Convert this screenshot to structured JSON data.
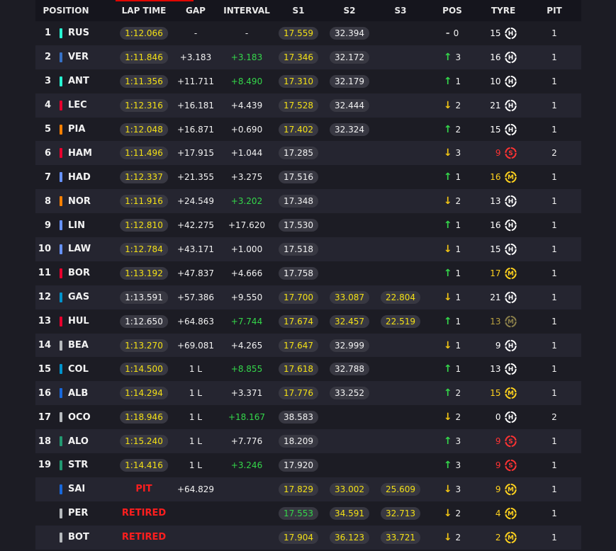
{
  "headers": {
    "position": "POSITION",
    "lap_time": "LAP TIME",
    "gap": "GAP",
    "interval": "INTERVAL",
    "s1": "S1",
    "s2": "S2",
    "s3": "S3",
    "pos": "POS",
    "tyre": "TYRE",
    "pit": "PIT"
  },
  "colors": {
    "pill_yellow": "#f3e015",
    "pill_green": "#34d74a",
    "retired": "#ff1e1e",
    "arrow_up": "#34d74a",
    "arrow_down": "#f3c613"
  },
  "rows": [
    {
      "pos": "1",
      "code": "RUS",
      "team_color": "#27f4d2",
      "lap": "1:12.066",
      "lap_pb": true,
      "gap": "-",
      "interval": "-",
      "interval_green": false,
      "s1": "17.559",
      "s1_c": "y",
      "s2": "32.394",
      "s2_c": "w",
      "s3": "",
      "s3_c": "",
      "pos_dir": "eq",
      "pos_change": "0",
      "tyre_laps": "15",
      "tyre": "H",
      "tyre_col": "#ffffff",
      "laps_col": "#ffffff",
      "pit": "1"
    },
    {
      "pos": "2",
      "code": "VER",
      "team_color": "#3671c6",
      "lap": "1:11.846",
      "lap_pb": true,
      "gap": "+3.183",
      "interval": "+3.183",
      "interval_green": true,
      "s1": "17.346",
      "s1_c": "y",
      "s2": "32.172",
      "s2_c": "w",
      "s3": "",
      "s3_c": "",
      "pos_dir": "up",
      "pos_change": "3",
      "tyre_laps": "16",
      "tyre": "H",
      "tyre_col": "#ffffff",
      "laps_col": "#ffffff",
      "pit": "1"
    },
    {
      "pos": "3",
      "code": "ANT",
      "team_color": "#27f4d2",
      "lap": "1:11.356",
      "lap_pb": true,
      "gap": "+11.711",
      "interval": "+8.490",
      "interval_green": true,
      "s1": "17.310",
      "s1_c": "y",
      "s2": "32.179",
      "s2_c": "w",
      "s3": "",
      "s3_c": "",
      "pos_dir": "up",
      "pos_change": "1",
      "tyre_laps": "10",
      "tyre": "H",
      "tyre_col": "#ffffff",
      "laps_col": "#ffffff",
      "pit": "1"
    },
    {
      "pos": "4",
      "code": "LEC",
      "team_color": "#e8002d",
      "lap": "1:12.316",
      "lap_pb": true,
      "gap": "+16.181",
      "interval": "+4.439",
      "interval_green": false,
      "s1": "17.528",
      "s1_c": "y",
      "s2": "32.444",
      "s2_c": "w",
      "s3": "",
      "s3_c": "",
      "pos_dir": "down",
      "pos_change": "2",
      "tyre_laps": "21",
      "tyre": "H",
      "tyre_col": "#ffffff",
      "laps_col": "#ffffff",
      "pit": "1"
    },
    {
      "pos": "5",
      "code": "PIA",
      "team_color": "#ff8000",
      "lap": "1:12.048",
      "lap_pb": true,
      "gap": "+16.871",
      "interval": "+0.690",
      "interval_green": false,
      "s1": "17.402",
      "s1_c": "y",
      "s2": "32.324",
      "s2_c": "w",
      "s3": "",
      "s3_c": "",
      "pos_dir": "up",
      "pos_change": "2",
      "tyre_laps": "15",
      "tyre": "H",
      "tyre_col": "#ffffff",
      "laps_col": "#ffffff",
      "pit": "1"
    },
    {
      "pos": "6",
      "code": "HAM",
      "team_color": "#e8002d",
      "lap": "1:11.496",
      "lap_pb": true,
      "gap": "+17.915",
      "interval": "+1.044",
      "interval_green": false,
      "s1": "17.285",
      "s1_c": "w",
      "s2": "",
      "s2_c": "",
      "s3": "",
      "s3_c": "",
      "pos_dir": "down",
      "pos_change": "3",
      "tyre_laps": "9",
      "tyre": "S",
      "tyre_col": "#ff3333",
      "laps_col": "#ff3333",
      "pit": "2"
    },
    {
      "pos": "7",
      "code": "HAD",
      "team_color": "#6692ff",
      "lap": "1:12.337",
      "lap_pb": true,
      "gap": "+21.355",
      "interval": "+3.275",
      "interval_green": false,
      "s1": "17.516",
      "s1_c": "w",
      "s2": "",
      "s2_c": "",
      "s3": "",
      "s3_c": "",
      "pos_dir": "up",
      "pos_change": "1",
      "tyre_laps": "16",
      "tyre": "M",
      "tyre_col": "#ffd21e",
      "laps_col": "#ffd21e",
      "pit": "1"
    },
    {
      "pos": "8",
      "code": "NOR",
      "team_color": "#ff8000",
      "lap": "1:11.916",
      "lap_pb": true,
      "gap": "+24.549",
      "interval": "+3.202",
      "interval_green": true,
      "s1": "17.348",
      "s1_c": "w",
      "s2": "",
      "s2_c": "",
      "s3": "",
      "s3_c": "",
      "pos_dir": "down",
      "pos_change": "2",
      "tyre_laps": "13",
      "tyre": "H",
      "tyre_col": "#ffffff",
      "laps_col": "#ffffff",
      "pit": "1"
    },
    {
      "pos": "9",
      "code": "LIN",
      "team_color": "#6692ff",
      "lap": "1:12.810",
      "lap_pb": true,
      "gap": "+42.275",
      "interval": "+17.620",
      "interval_green": false,
      "s1": "17.530",
      "s1_c": "w",
      "s2": "",
      "s2_c": "",
      "s3": "",
      "s3_c": "",
      "pos_dir": "up",
      "pos_change": "1",
      "tyre_laps": "16",
      "tyre": "H",
      "tyre_col": "#ffffff",
      "laps_col": "#ffffff",
      "pit": "1"
    },
    {
      "pos": "10",
      "code": "LAW",
      "team_color": "#6692ff",
      "lap": "1:12.784",
      "lap_pb": true,
      "gap": "+43.171",
      "interval": "+1.000",
      "interval_green": false,
      "s1": "17.518",
      "s1_c": "w",
      "s2": "",
      "s2_c": "",
      "s3": "",
      "s3_c": "",
      "pos_dir": "down",
      "pos_change": "1",
      "tyre_laps": "15",
      "tyre": "H",
      "tyre_col": "#ffffff",
      "laps_col": "#ffffff",
      "pit": "1"
    },
    {
      "pos": "11",
      "code": "BOR",
      "team_color": "#e8002d",
      "lap": "1:13.192",
      "lap_pb": true,
      "gap": "+47.837",
      "interval": "+4.666",
      "interval_green": false,
      "s1": "17.758",
      "s1_c": "w",
      "s2": "",
      "s2_c": "",
      "s3": "",
      "s3_c": "",
      "pos_dir": "up",
      "pos_change": "1",
      "tyre_laps": "17",
      "tyre": "M",
      "tyre_col": "#ffd21e",
      "laps_col": "#ffd21e",
      "pit": "1"
    },
    {
      "pos": "12",
      "code": "GAS",
      "team_color": "#0093cc",
      "lap": "1:13.591",
      "lap_pb": false,
      "gap": "+57.386",
      "interval": "+9.550",
      "interval_green": false,
      "s1": "17.700",
      "s1_c": "y",
      "s2": "33.087",
      "s2_c": "y",
      "s3": "22.804",
      "s3_c": "y",
      "pos_dir": "down",
      "pos_change": "1",
      "tyre_laps": "21",
      "tyre": "H",
      "tyre_col": "#ffffff",
      "laps_col": "#ffffff",
      "pit": "1"
    },
    {
      "pos": "13",
      "code": "HUL",
      "team_color": "#e8002d",
      "lap": "1:12.650",
      "lap_pb": false,
      "gap": "+64.863",
      "interval": "+7.744",
      "interval_green": true,
      "s1": "17.674",
      "s1_c": "y",
      "s2": "32.457",
      "s2_c": "y",
      "s3": "22.519",
      "s3_c": "y",
      "pos_dir": "up",
      "pos_change": "1",
      "tyre_laps": "13",
      "tyre": "M",
      "tyre_col": "#8a7f4a",
      "laps_col": "#b8a040",
      "pit": "1"
    },
    {
      "pos": "14",
      "code": "BEA",
      "team_color": "#b6babd",
      "lap": "1:13.270",
      "lap_pb": true,
      "gap": "+69.081",
      "interval": "+4.265",
      "interval_green": false,
      "s1": "17.647",
      "s1_c": "y",
      "s2": "32.999",
      "s2_c": "w",
      "s3": "",
      "s3_c": "",
      "pos_dir": "down",
      "pos_change": "1",
      "tyre_laps": "9",
      "tyre": "H",
      "tyre_col": "#ffffff",
      "laps_col": "#ffffff",
      "pit": "1"
    },
    {
      "pos": "15",
      "code": "COL",
      "team_color": "#0093cc",
      "lap": "1:14.500",
      "lap_pb": true,
      "gap": "1 L",
      "interval": "+8.855",
      "interval_green": true,
      "s1": "17.618",
      "s1_c": "y",
      "s2": "32.788",
      "s2_c": "w",
      "s3": "",
      "s3_c": "",
      "pos_dir": "up",
      "pos_change": "1",
      "tyre_laps": "13",
      "tyre": "H",
      "tyre_col": "#ffffff",
      "laps_col": "#ffffff",
      "pit": "1"
    },
    {
      "pos": "16",
      "code": "ALB",
      "team_color": "#1868db",
      "lap": "1:14.294",
      "lap_pb": true,
      "gap": "1 L",
      "interval": "+3.371",
      "interval_green": false,
      "s1": "17.776",
      "s1_c": "y",
      "s2": "33.252",
      "s2_c": "w",
      "s3": "",
      "s3_c": "",
      "pos_dir": "up",
      "pos_change": "2",
      "tyre_laps": "15",
      "tyre": "M",
      "tyre_col": "#ffd21e",
      "laps_col": "#ffd21e",
      "pit": "1"
    },
    {
      "pos": "17",
      "code": "OCO",
      "team_color": "#b6babd",
      "lap": "1:18.946",
      "lap_pb": true,
      "gap": "1 L",
      "interval": "+18.167",
      "interval_green": true,
      "s1": "38.583",
      "s1_c": "w",
      "s2": "",
      "s2_c": "",
      "s3": "",
      "s3_c": "",
      "pos_dir": "down",
      "pos_change": "2",
      "tyre_laps": "0",
      "tyre": "H",
      "tyre_col": "#ffffff",
      "laps_col": "#ffffff",
      "pit": "2"
    },
    {
      "pos": "18",
      "code": "ALO",
      "team_color": "#229971",
      "lap": "1:15.240",
      "lap_pb": true,
      "gap": "1 L",
      "interval": "+7.776",
      "interval_green": false,
      "s1": "18.209",
      "s1_c": "w",
      "s2": "",
      "s2_c": "",
      "s3": "",
      "s3_c": "",
      "pos_dir": "up",
      "pos_change": "3",
      "tyre_laps": "9",
      "tyre": "S",
      "tyre_col": "#ff3333",
      "laps_col": "#ff3333",
      "pit": "1"
    },
    {
      "pos": "19",
      "code": "STR",
      "team_color": "#229971",
      "lap": "1:14.416",
      "lap_pb": true,
      "gap": "1 L",
      "interval": "+3.246",
      "interval_green": true,
      "s1": "17.920",
      "s1_c": "w",
      "s2": "",
      "s2_c": "",
      "s3": "",
      "s3_c": "",
      "pos_dir": "up",
      "pos_change": "3",
      "tyre_laps": "9",
      "tyre": "S",
      "tyre_col": "#ff3333",
      "laps_col": "#ff3333",
      "pit": "1"
    },
    {
      "pos": "",
      "code": "SAI",
      "team_color": "#1868db",
      "lap": "PIT",
      "lap_status": true,
      "gap": "+64.829",
      "interval": "",
      "interval_green": false,
      "s1": "17.829",
      "s1_c": "y",
      "s2": "33.002",
      "s2_c": "y",
      "s3": "25.609",
      "s3_c": "y",
      "pos_dir": "down",
      "pos_change": "3",
      "tyre_laps": "9",
      "tyre": "M",
      "tyre_col": "#ffd21e",
      "laps_col": "#ffd21e",
      "pit": "1"
    },
    {
      "pos": "",
      "code": "PER",
      "team_color": "#b6babd",
      "lap": "RETIRED",
      "lap_status": true,
      "gap": "",
      "interval": "",
      "interval_green": false,
      "s1": "17.553",
      "s1_c": "g",
      "s2": "34.591",
      "s2_c": "y",
      "s3": "32.713",
      "s3_c": "y",
      "pos_dir": "down",
      "pos_change": "2",
      "tyre_laps": "4",
      "tyre": "M",
      "tyre_col": "#ffd21e",
      "laps_col": "#ffd21e",
      "pit": "1"
    },
    {
      "pos": "",
      "code": "BOT",
      "team_color": "#b6babd",
      "lap": "RETIRED",
      "lap_status": true,
      "gap": "",
      "interval": "",
      "interval_green": false,
      "s1": "17.904",
      "s1_c": "y",
      "s2": "36.123",
      "s2_c": "y",
      "s3": "33.721",
      "s3_c": "y",
      "pos_dir": "down",
      "pos_change": "2",
      "tyre_laps": "2",
      "tyre": "M",
      "tyre_col": "#ffd21e",
      "laps_col": "#ffd21e",
      "pit": "1"
    }
  ]
}
